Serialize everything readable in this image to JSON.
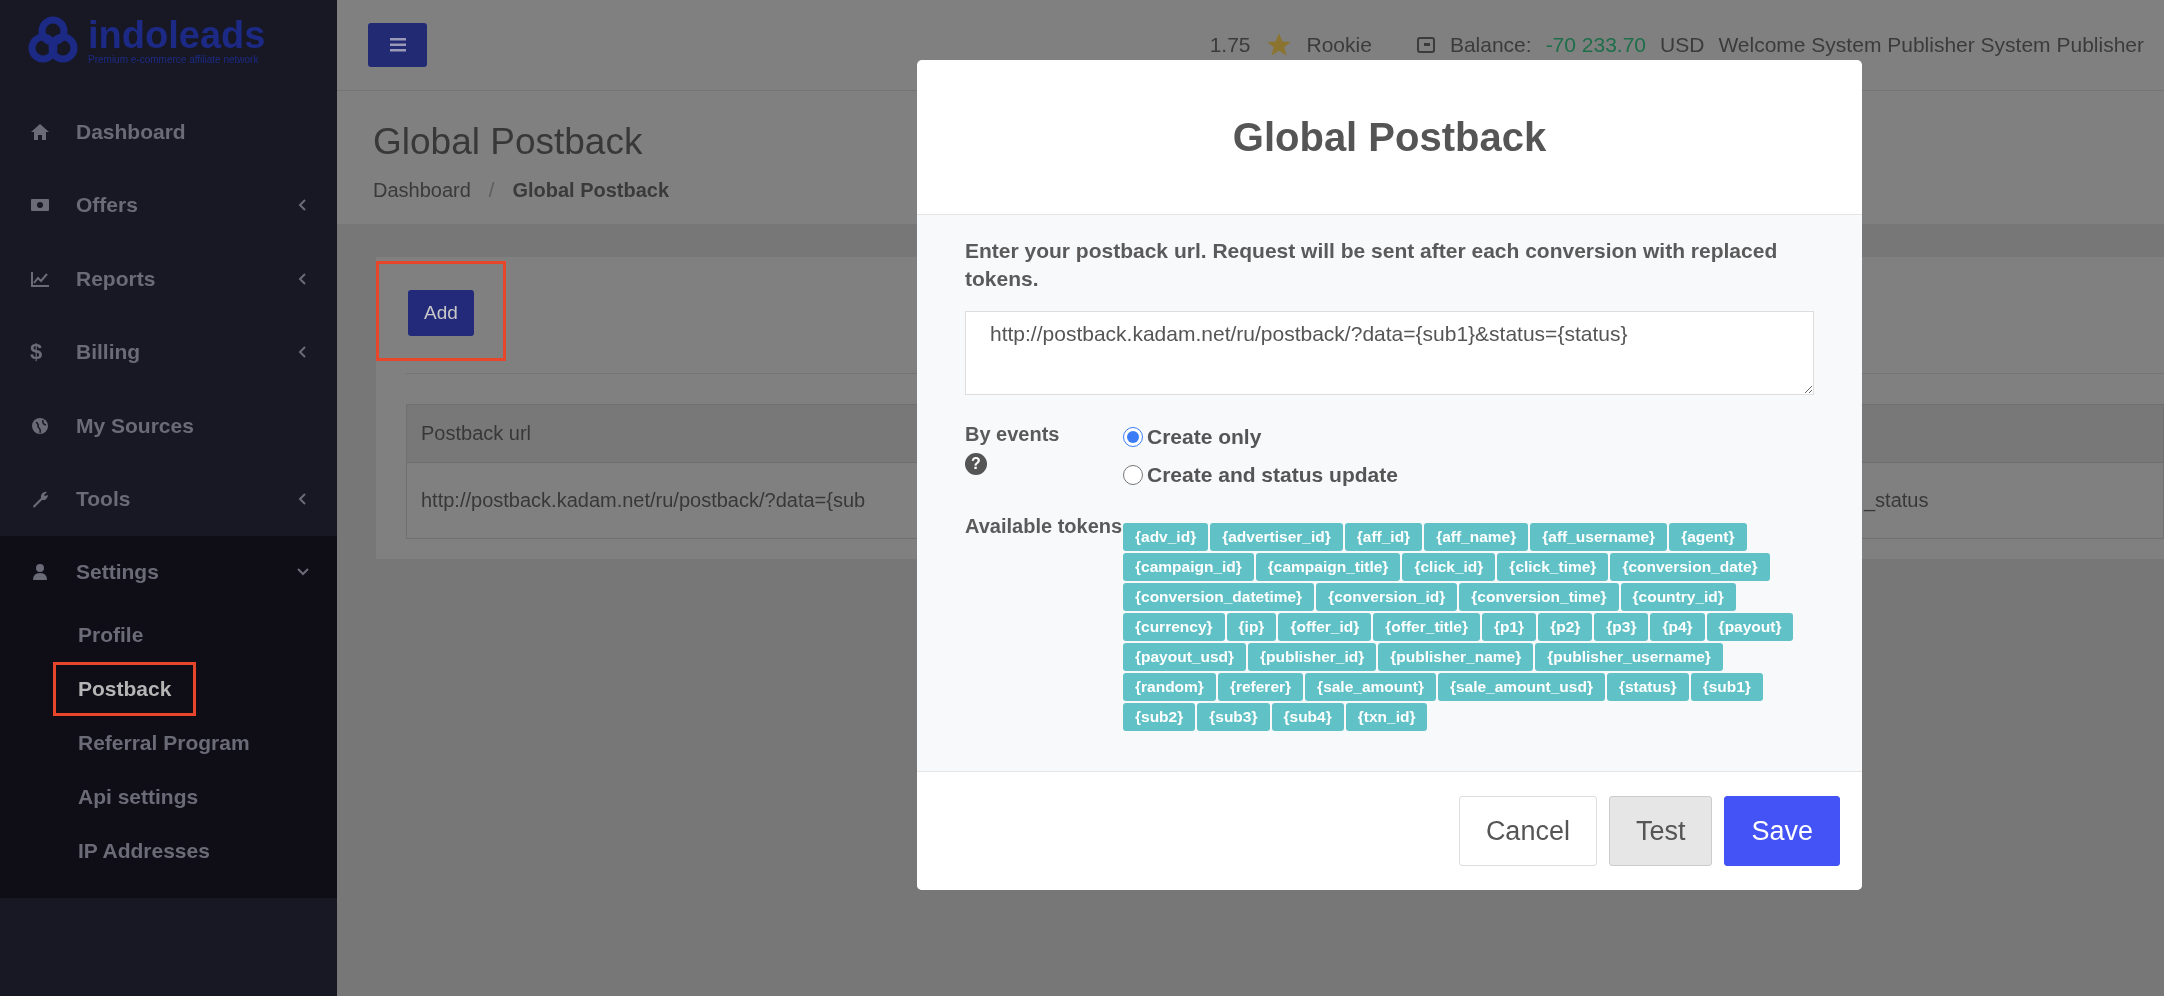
{
  "logo": {
    "name": "indoleads",
    "tagline": "Premium e-commerce affiliate network"
  },
  "sidebar": {
    "items": [
      {
        "label": "Dashboard",
        "kind": "link"
      },
      {
        "label": "Offers",
        "kind": "group",
        "expanded": false
      },
      {
        "label": "Reports",
        "kind": "group",
        "expanded": false
      },
      {
        "label": "Billing",
        "kind": "group",
        "expanded": false,
        "glyph": "$"
      },
      {
        "label": "My Sources",
        "kind": "link"
      },
      {
        "label": "Tools",
        "kind": "group",
        "expanded": false
      },
      {
        "label": "Settings",
        "kind": "group",
        "expanded": true,
        "children": [
          {
            "label": "Profile",
            "selected": false
          },
          {
            "label": "Postback",
            "selected": true
          },
          {
            "label": "Referral Program",
            "selected": false
          },
          {
            "label": "Api settings",
            "selected": false
          },
          {
            "label": "IP Addresses",
            "selected": false
          }
        ]
      }
    ]
  },
  "topbar": {
    "rating": "1.75",
    "rank": "Rookie",
    "balance_label": "Balance:",
    "balance": "-70 233.70",
    "currency": "USD",
    "welcome": "Welcome System Publisher System Publisher"
  },
  "page": {
    "title": "Global Postback",
    "breadcrumb": [
      {
        "label": "Dashboard",
        "selected": false
      },
      {
        "label": "/",
        "selected": false
      },
      {
        "label": "Global Postback",
        "selected": true
      }
    ],
    "add_button": {
      "label": "Add",
      "highlighted": true
    },
    "table": {
      "columns": [
        "Postback url"
      ],
      "rows": [
        {
          "column_1": "http://postback.kadam.net/ru/postback/?data={sub",
          "column_3": "_status"
        }
      ]
    }
  },
  "modal": {
    "title": "Global Postback",
    "intro": "Enter your postback url. Request will be sent after each conversion with replaced tokens.",
    "url": "http://postback.kadam.net/ru/postback/?data={sub1}&status={status}",
    "events_label": "By events",
    "help_glyph": "?",
    "events": [
      {
        "label": "Create only",
        "selected": true
      },
      {
        "label": "Create and status update",
        "selected": false
      }
    ],
    "tokens_label": "Available tokens",
    "tokens": [
      "{adv_id}",
      "{advertiser_id}",
      "{aff_id}",
      "{aff_name}",
      "{aff_username}",
      "{agent}",
      "{campaign_id}",
      "{campaign_title}",
      "{click_id}",
      "{click_time}",
      "{conversion_date}",
      "{conversion_datetime}",
      "{conversion_id}",
      "{conversion_time}",
      "{country_id}",
      "{currency}",
      "{ip}",
      "{offer_id}",
      "{offer_title}",
      "{p1}",
      "{p2}",
      "{p3}",
      "{p4}",
      "{payout}",
      "{payout_usd}",
      "{publisher_id}",
      "{publisher_name}",
      "{publisher_username}",
      "{random}",
      "{referer}",
      "{sale_amount}",
      "{sale_amount_usd}",
      "{status}",
      "{sub1}",
      "{sub2}",
      "{sub3}",
      "{sub4}",
      "{txn_id}"
    ],
    "buttons": [
      {
        "label": "Cancel",
        "kind": "secondary"
      },
      {
        "label": "Test",
        "kind": "neutral"
      },
      {
        "label": "Save",
        "kind": "primary"
      }
    ]
  }
}
